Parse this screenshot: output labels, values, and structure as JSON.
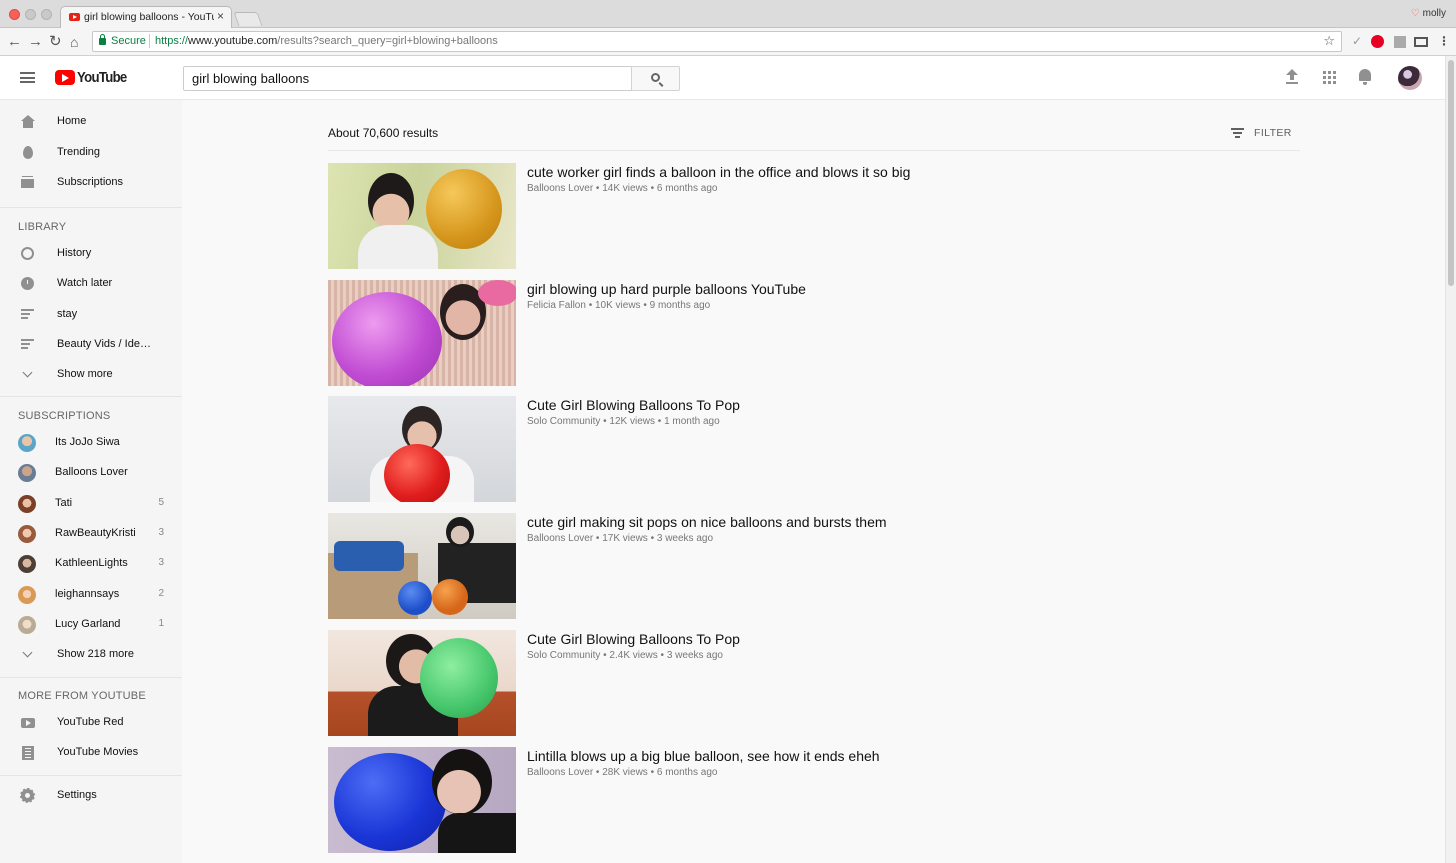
{
  "browser": {
    "tab_title": "girl blowing balloons - YouTube",
    "close_glyph": "×",
    "profile_name": "molly",
    "secure_label": "Secure",
    "url_scheme": "https://",
    "url_host": "www.youtube.com",
    "url_path": "/results?search_query=girl+blowing+balloons"
  },
  "header": {
    "logo_text": "YouTube",
    "search_value": "girl blowing balloons"
  },
  "sidebar": {
    "main": [
      {
        "label": "Home",
        "icon": "home-icon"
      },
      {
        "label": "Trending",
        "icon": "trending-icon"
      },
      {
        "label": "Subscriptions",
        "icon": "subscriptions-icon"
      }
    ],
    "library_heading": "LIBRARY",
    "library": [
      {
        "label": "History",
        "icon": "history-icon"
      },
      {
        "label": "Watch later",
        "icon": "watch-later-icon"
      },
      {
        "label": "stay",
        "icon": "playlist-icon"
      },
      {
        "label": "Beauty Vids / Ide…",
        "icon": "playlist-icon"
      },
      {
        "label": "Show more",
        "icon": "chevron-down-icon"
      }
    ],
    "subscriptions_heading": "SUBSCRIPTIONS",
    "subscriptions": [
      {
        "label": "Its JoJo Siwa",
        "count": "",
        "avatar_color": "#7fb6c9"
      },
      {
        "label": "Balloons Lover",
        "count": "",
        "avatar_color": "#8a9bb0"
      },
      {
        "label": "Tati",
        "count": "5",
        "avatar_color": "#c7865f"
      },
      {
        "label": "RawBeautyKristi",
        "count": "3",
        "avatar_color": "#b9826a"
      },
      {
        "label": "KathleenLights",
        "count": "3",
        "avatar_color": "#7a6a5e"
      },
      {
        "label": "leighannsays",
        "count": "2",
        "avatar_color": "#e0b58a"
      },
      {
        "label": "Lucy Garland",
        "count": "1",
        "avatar_color": "#d9d2c4"
      }
    ],
    "show_more_subs": "Show 218 more",
    "more_heading": "MORE FROM YOUTUBE",
    "more": [
      {
        "label": "YouTube Red",
        "icon": "youtube-red-icon"
      },
      {
        "label": "YouTube Movies",
        "icon": "youtube-movies-icon"
      }
    ],
    "settings_label": "Settings"
  },
  "results": {
    "count_text": "About 70,600 results",
    "filter_label": "FILTER",
    "videos": [
      {
        "title": "cute worker girl finds a balloon in the office and blows it so big",
        "channel": "Balloons Lover",
        "views": "14K views",
        "age": "6 months ago"
      },
      {
        "title": "girl blowing up hard purple balloons YouTube",
        "channel": "Felicia Fallon",
        "views": "10K views",
        "age": "9 months ago"
      },
      {
        "title": "Cute Girl Blowing Balloons To Pop",
        "channel": "Solo Community",
        "views": "12K views",
        "age": "1 month ago"
      },
      {
        "title": "cute girl making sit pops on nice balloons and bursts them",
        "channel": "Balloons Lover",
        "views": "17K views",
        "age": "3 weeks ago"
      },
      {
        "title": "Cute Girl Blowing Balloons To Pop",
        "channel": "Solo Community",
        "views": "2.4K views",
        "age": "3 weeks ago"
      },
      {
        "title": "Lintilla blows up a big blue balloon, see how it ends eheh",
        "channel": "Balloons Lover",
        "views": "28K views",
        "age": "6 months ago"
      }
    ]
  },
  "colors": {
    "brand_red": "#ff0000",
    "secure_green": "#0b8043"
  }
}
